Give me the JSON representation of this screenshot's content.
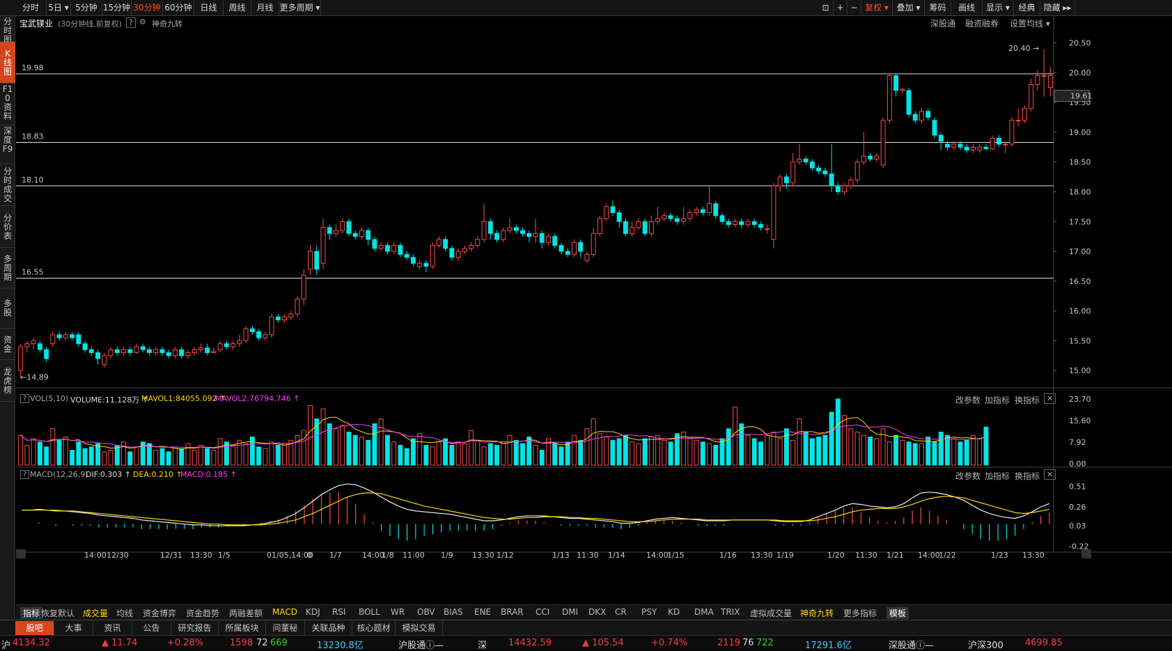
{
  "toolbar": {
    "periods": [
      "分时",
      "5日",
      "5分钟",
      "15分钟",
      "30分钟",
      "60分钟",
      "日线",
      "周线",
      "月线",
      "更多周期"
    ],
    "active_period": "30分钟",
    "right": [
      "复权",
      "叠加",
      "筹码",
      "画线",
      "显示",
      "经典",
      "隐藏"
    ],
    "active_right": "复权"
  },
  "leftnav": [
    "分时图",
    "K线图",
    "F10资料",
    "深度F9",
    "分时成交",
    "分价表",
    "多周期",
    "多股",
    "资金",
    "龙虎榜"
  ],
  "leftnav_active": "K线图",
  "title": {
    "stock": "宝武镁业",
    "desc": "(30分钟线,前复权)",
    "help": "?",
    "indicator": "神奇九转"
  },
  "title_right": [
    "深股通",
    "融资融券",
    "设置均线"
  ],
  "price_axis": [
    "20.50",
    "20.00",
    "19.50",
    "19.00",
    "18.50",
    "18.00",
    "17.50",
    "17.00",
    "16.50",
    "16.00",
    "15.50",
    "15.00"
  ],
  "current_price": "19.61",
  "hlines": [
    "19.98",
    "18.83",
    "18.10",
    "16.55"
  ],
  "high_label": "20.40",
  "low_label": "14.89",
  "vol_header": {
    "name": "VOL(5,10)",
    "volume": "VOLUME:11.128万",
    "mavol1": "MAVOL1:84055.092",
    "mavol2": "MAVOL2:76794.746"
  },
  "vol_axis": [
    "23.70",
    "15.60",
    "7.92",
    "0.00"
  ],
  "macd_header": {
    "name": "MACD(12,26,9)",
    "dif": "DIF:0.303",
    "dea": "DEA:0.210",
    "macd": "MACD:0.185"
  },
  "macd_axis": [
    "0.51",
    "0.26",
    "0.03",
    "-0.22"
  ],
  "sub_links": [
    "改参数",
    "加指标",
    "换指标"
  ],
  "time_axis": [
    "14:00",
    "12/30",
    "12/31",
    "13:30",
    "1/5",
    "01/05,14:00",
    "0",
    "1/7",
    "14:00",
    "1/8",
    "11:00",
    "1/9",
    "13:30",
    "1/12",
    "1/13",
    "11:30",
    "1/14",
    "14:00",
    "1/15",
    "1/16",
    "13:30",
    "1/19",
    "1/20",
    "11:30",
    "1/21",
    "14:00",
    "1/22",
    "1/23",
    "13:30"
  ],
  "indicators": [
    "指标",
    "恢复默认",
    "成交量",
    "均线",
    "资金博弈",
    "资金趋势",
    "两融差额",
    "MACD",
    "KDJ",
    "RSI",
    "BOLL",
    "WR",
    "OBV",
    "BIAS",
    "ENE",
    "BRAR",
    "CCI",
    "DMI",
    "DKX",
    "CR",
    "PSY",
    "KD",
    "DMA",
    "TRIX",
    "虚拟成交量",
    "神奇九转",
    "更多指标",
    "模板"
  ],
  "tabs": [
    "股吧",
    "大事",
    "资讯",
    "公告",
    "研究报告",
    "所属板块",
    "问董秘",
    "关联品种",
    "核心题材",
    "模拟交易"
  ],
  "status": {
    "sh_label": "沪",
    "sh_price": "4134.32",
    "sh_chg": "▲ 11.74",
    "sh_pct": "+0.28%",
    "sh_up": "1598",
    "sh_flat": "72",
    "sh_down": "669",
    "sh_amt": "13230.8亿",
    "hgt": "沪股通",
    "sz_label": "深",
    "sz_price": "14432.59",
    "sz_chg": "▲ 105.54",
    "sz_pct": "+0.74%",
    "sz_up": "2119",
    "sz_flat": "76",
    "sz_down": "722",
    "sz_amt": "17291.6亿",
    "sgt": "深股通",
    "hs300": "沪深300",
    "hs300_val": "4699.85"
  },
  "chart_data": {
    "type": "candlestick",
    "title": "宝武镁业 (30分钟线,前复权)",
    "ylim": [
      14.85,
      20.6
    ],
    "candles": [
      [
        15.0,
        15.4,
        14.89,
        15.45
      ],
      [
        15.4,
        15.45,
        15.3,
        15.5
      ],
      [
        15.45,
        15.5,
        15.35,
        15.55
      ],
      [
        15.45,
        15.35,
        15.3,
        15.5
      ],
      [
        15.35,
        15.2,
        15.15,
        15.4
      ],
      [
        15.45,
        15.6,
        15.4,
        15.65
      ],
      [
        15.6,
        15.55,
        15.5,
        15.65
      ],
      [
        15.55,
        15.6,
        15.5,
        15.65
      ],
      [
        15.6,
        15.55,
        15.5,
        15.65
      ],
      [
        15.6,
        15.45,
        15.4,
        15.65
      ],
      [
        15.45,
        15.35,
        15.3,
        15.5
      ],
      [
        15.35,
        15.3,
        15.25,
        15.4
      ],
      [
        15.3,
        15.2,
        15.1,
        15.35
      ],
      [
        15.1,
        15.25,
        15.05,
        15.3
      ],
      [
        15.25,
        15.35,
        15.2,
        15.4
      ],
      [
        15.35,
        15.3,
        15.25,
        15.4
      ],
      [
        15.3,
        15.35,
        15.25,
        15.4
      ],
      [
        15.35,
        15.3,
        15.25,
        15.4
      ],
      [
        15.3,
        15.4,
        15.28,
        15.45
      ],
      [
        15.4,
        15.35,
        15.3,
        15.45
      ],
      [
        15.35,
        15.3,
        15.25,
        15.4
      ],
      [
        15.3,
        15.35,
        15.25,
        15.4
      ],
      [
        15.35,
        15.3,
        15.25,
        15.4
      ],
      [
        15.3,
        15.25,
        15.2,
        15.35
      ],
      [
        15.25,
        15.35,
        15.2,
        15.4
      ],
      [
        15.35,
        15.25,
        15.2,
        15.4
      ],
      [
        15.25,
        15.3,
        15.2,
        15.35
      ],
      [
        15.3,
        15.35,
        15.25,
        15.4
      ],
      [
        15.35,
        15.38,
        15.3,
        15.45
      ],
      [
        15.38,
        15.3,
        15.25,
        15.45
      ],
      [
        15.3,
        15.32,
        15.28,
        15.38
      ],
      [
        15.35,
        15.45,
        15.3,
        15.5
      ],
      [
        15.45,
        15.4,
        15.35,
        15.5
      ],
      [
        15.4,
        15.45,
        15.35,
        15.5
      ],
      [
        15.45,
        15.5,
        15.4,
        15.6
      ],
      [
        15.5,
        15.7,
        15.45,
        15.75
      ],
      [
        15.7,
        15.65,
        15.6,
        15.75
      ],
      [
        15.65,
        15.55,
        15.5,
        15.7
      ],
      [
        15.55,
        15.6,
        15.5,
        15.65
      ],
      [
        15.6,
        15.9,
        15.55,
        15.95
      ],
      [
        15.9,
        15.85,
        15.8,
        15.95
      ],
      [
        15.85,
        15.9,
        15.8,
        15.95
      ],
      [
        15.9,
        15.95,
        15.85,
        16.0
      ],
      [
        15.95,
        16.2,
        15.9,
        16.25
      ],
      [
        16.2,
        16.6,
        16.1,
        16.7
      ],
      [
        16.7,
        17.0,
        16.6,
        17.1
      ],
      [
        17.0,
        16.7,
        16.6,
        17.1
      ],
      [
        16.8,
        17.4,
        16.7,
        17.55
      ],
      [
        17.4,
        17.3,
        17.2,
        17.45
      ],
      [
        17.3,
        17.35,
        17.25,
        17.45
      ],
      [
        17.35,
        17.5,
        17.3,
        17.55
      ],
      [
        17.5,
        17.3,
        17.25,
        17.55
      ],
      [
        17.3,
        17.25,
        17.2,
        17.35
      ],
      [
        17.25,
        17.35,
        17.2,
        17.4
      ],
      [
        17.35,
        17.2,
        17.1,
        17.4
      ],
      [
        17.2,
        17.05,
        17.0,
        17.25
      ],
      [
        17.05,
        17.1,
        17.0,
        17.15
      ],
      [
        17.1,
        17.0,
        16.95,
        17.15
      ],
      [
        17.0,
        17.1,
        16.95,
        17.15
      ],
      [
        17.1,
        16.95,
        16.9,
        17.15
      ],
      [
        16.95,
        16.9,
        16.85,
        17.0
      ],
      [
        16.9,
        16.8,
        16.75,
        16.95
      ],
      [
        16.75,
        16.8,
        16.7,
        16.85
      ],
      [
        16.8,
        16.75,
        16.65,
        16.85
      ],
      [
        16.75,
        17.1,
        16.7,
        17.15
      ],
      [
        17.1,
        17.2,
        17.05,
        17.25
      ],
      [
        17.2,
        17.05,
        17.0,
        17.25
      ],
      [
        17.05,
        16.9,
        16.85,
        17.1
      ],
      [
        16.9,
        17.0,
        16.85,
        17.05
      ],
      [
        17.0,
        17.05,
        16.95,
        17.1
      ],
      [
        17.05,
        17.1,
        17.0,
        17.15
      ],
      [
        17.1,
        17.2,
        17.05,
        17.25
      ],
      [
        17.2,
        17.5,
        17.15,
        17.8
      ],
      [
        17.5,
        17.3,
        17.2,
        17.55
      ],
      [
        17.3,
        17.2,
        17.15,
        17.35
      ],
      [
        17.2,
        17.35,
        17.15,
        17.4
      ],
      [
        17.35,
        17.4,
        17.3,
        17.55
      ],
      [
        17.4,
        17.35,
        17.3,
        17.45
      ],
      [
        17.35,
        17.3,
        17.25,
        17.4
      ],
      [
        17.3,
        17.25,
        17.15,
        17.35
      ],
      [
        17.25,
        17.3,
        17.15,
        17.55
      ],
      [
        17.3,
        17.15,
        17.05,
        17.35
      ],
      [
        17.15,
        17.25,
        17.1,
        17.3
      ],
      [
        17.25,
        17.1,
        17.05,
        17.3
      ],
      [
        17.1,
        17.0,
        16.95,
        17.15
      ],
      [
        17.0,
        16.95,
        16.9,
        17.05
      ],
      [
        16.95,
        17.15,
        16.9,
        17.2
      ],
      [
        17.15,
        17.0,
        16.9,
        17.2
      ],
      [
        16.85,
        16.95,
        16.8,
        17.0
      ],
      [
        16.95,
        17.3,
        16.9,
        17.4
      ],
      [
        17.3,
        17.55,
        17.25,
        17.6
      ],
      [
        17.55,
        17.75,
        17.5,
        17.8
      ],
      [
        17.75,
        17.65,
        17.6,
        17.85
      ],
      [
        17.65,
        17.5,
        17.4,
        17.7
      ],
      [
        17.5,
        17.3,
        17.25,
        17.55
      ],
      [
        17.3,
        17.4,
        17.25,
        17.5
      ],
      [
        17.4,
        17.5,
        17.35,
        17.55
      ],
      [
        17.5,
        17.3,
        17.25,
        17.55
      ],
      [
        17.3,
        17.5,
        17.25,
        17.6
      ],
      [
        17.5,
        17.55,
        17.45,
        17.75
      ],
      [
        17.55,
        17.6,
        17.5,
        17.65
      ],
      [
        17.6,
        17.55,
        17.5,
        17.65
      ],
      [
        17.55,
        17.5,
        17.45,
        17.6
      ],
      [
        17.5,
        17.55,
        17.45,
        17.75
      ],
      [
        17.55,
        17.65,
        17.5,
        17.7
      ],
      [
        17.65,
        17.7,
        17.6,
        17.75
      ],
      [
        17.7,
        17.65,
        17.6,
        17.75
      ],
      [
        17.65,
        17.8,
        17.6,
        18.1
      ],
      [
        17.8,
        17.6,
        17.55,
        17.85
      ],
      [
        17.6,
        17.5,
        17.45,
        17.65
      ],
      [
        17.5,
        17.45,
        17.4,
        17.55
      ],
      [
        17.45,
        17.5,
        17.4,
        17.55
      ],
      [
        17.5,
        17.45,
        17.4,
        17.55
      ],
      [
        17.45,
        17.5,
        17.4,
        17.55
      ],
      [
        17.5,
        17.45,
        17.4,
        17.55
      ],
      [
        17.45,
        17.4,
        17.35,
        17.5
      ],
      [
        17.38,
        17.38,
        17.3,
        17.45
      ],
      [
        17.2,
        18.1,
        17.05,
        18.15
      ],
      [
        18.1,
        18.25,
        18.0,
        18.3
      ],
      [
        18.25,
        18.15,
        18.05,
        18.3
      ],
      [
        18.15,
        18.5,
        18.1,
        18.65
      ],
      [
        18.5,
        18.55,
        18.45,
        18.8
      ],
      [
        18.55,
        18.5,
        18.45,
        18.6
      ],
      [
        18.5,
        18.4,
        18.35,
        18.55
      ],
      [
        18.4,
        18.35,
        18.3,
        18.45
      ],
      [
        18.35,
        18.3,
        18.25,
        18.4
      ],
      [
        18.3,
        18.1,
        18.0,
        18.8
      ],
      [
        18.1,
        18.0,
        17.95,
        18.15
      ],
      [
        18.0,
        18.1,
        17.95,
        18.15
      ],
      [
        18.1,
        18.2,
        18.05,
        18.25
      ],
      [
        18.2,
        18.5,
        18.15,
        18.55
      ],
      [
        18.5,
        18.6,
        18.45,
        19.0
      ],
      [
        18.6,
        18.55,
        18.5,
        18.65
      ],
      [
        18.55,
        18.6,
        18.5,
        18.65
      ],
      [
        18.45,
        19.2,
        18.4,
        19.25
      ],
      [
        19.2,
        19.95,
        19.15,
        19.98
      ],
      [
        19.95,
        19.7,
        19.6,
        19.98
      ],
      [
        19.7,
        19.72,
        19.65,
        19.75
      ],
      [
        19.7,
        19.3,
        19.25,
        19.75
      ],
      [
        19.3,
        19.2,
        19.15,
        19.35
      ],
      [
        19.2,
        19.35,
        19.15,
        19.4
      ],
      [
        19.35,
        19.25,
        19.2,
        19.4
      ],
      [
        19.2,
        18.95,
        18.9,
        19.25
      ],
      [
        18.95,
        18.85,
        18.7,
        19.0
      ],
      [
        18.8,
        18.75,
        18.7,
        18.85
      ],
      [
        18.75,
        18.8,
        18.7,
        18.85
      ],
      [
        18.8,
        18.75,
        18.7,
        18.85
      ],
      [
        18.75,
        18.7,
        18.65,
        18.8
      ],
      [
        18.7,
        18.75,
        18.65,
        18.8
      ],
      [
        18.7,
        18.75,
        18.65,
        18.8
      ],
      [
        18.75,
        18.72,
        18.7,
        18.8
      ],
      [
        18.72,
        18.9,
        18.7,
        18.95
      ],
      [
        18.9,
        18.8,
        18.75,
        18.95
      ],
      [
        18.8,
        18.8,
        18.65,
        18.85
      ],
      [
        18.8,
        19.2,
        18.75,
        19.25
      ],
      [
        19.2,
        19.2,
        19.1,
        19.4
      ],
      [
        19.2,
        19.4,
        19.15,
        19.45
      ],
      [
        19.4,
        19.8,
        19.35,
        19.9
      ],
      [
        19.8,
        19.95,
        19.7,
        20.05
      ],
      [
        19.95,
        19.95,
        19.6,
        20.4
      ],
      [
        19.75,
        19.95,
        19.6,
        20.1
      ]
    ],
    "volume": [
      18,
      12,
      16,
      14,
      11,
      22,
      15,
      17,
      9,
      14,
      10,
      11,
      13,
      8,
      9,
      12,
      14,
      8,
      11,
      14,
      13,
      9,
      10,
      8,
      11,
      10,
      13,
      9,
      12,
      10,
      9,
      16,
      14,
      12,
      15,
      13,
      17,
      11,
      10,
      14,
      12,
      13,
      15,
      18,
      21,
      36,
      28,
      34,
      25,
      22,
      24,
      20,
      18,
      17,
      15,
      25,
      28,
      18,
      14,
      12,
      10,
      16,
      19,
      12,
      11,
      14,
      16,
      12,
      14,
      13,
      21,
      15,
      11,
      13,
      12,
      14,
      18,
      15,
      13,
      17,
      12,
      9,
      16,
      13,
      11,
      14,
      18,
      15,
      22,
      28,
      19,
      17,
      15,
      16,
      18,
      14,
      13,
      16,
      17,
      18,
      15,
      14,
      19,
      20,
      16,
      15,
      14,
      13,
      12,
      16,
      22,
      35,
      25,
      18,
      16,
      14,
      18,
      20,
      16,
      22,
      15,
      28,
      20,
      16,
      17,
      18,
      32,
      40,
      30,
      22,
      20,
      18,
      17,
      16,
      22,
      14,
      18,
      15,
      14,
      13,
      13,
      17,
      14,
      20,
      18,
      16,
      14,
      15,
      18,
      16,
      23
    ],
    "macd": {
      "dif": [
        0.22,
        0.22,
        0.23,
        0.22,
        0.21,
        0.21,
        0.2,
        0.19,
        0.18,
        0.16,
        0.15,
        0.14,
        0.13,
        0.12,
        0.1,
        0.09,
        0.08,
        0.07,
        0.06,
        0.05,
        0.04,
        0.04,
        0.03,
        0.03,
        0.03,
        0.03,
        0.03,
        0.04,
        0.05,
        0.07,
        0.09,
        0.13,
        0.18,
        0.25,
        0.33,
        0.41,
        0.47,
        0.52,
        0.54,
        0.53,
        0.49,
        0.44,
        0.38,
        0.32,
        0.27,
        0.23,
        0.21,
        0.2,
        0.19,
        0.18,
        0.17,
        0.15,
        0.13,
        0.11,
        0.09,
        0.09,
        0.1,
        0.12,
        0.14,
        0.15,
        0.15,
        0.15,
        0.14,
        0.13,
        0.12,
        0.12,
        0.11,
        0.1,
        0.09,
        0.08,
        0.06,
        0.06,
        0.07,
        0.09,
        0.11,
        0.12,
        0.13,
        0.12,
        0.11,
        0.1,
        0.09,
        0.09,
        0.09,
        0.1,
        0.1,
        0.1,
        0.1,
        0.1,
        0.09,
        0.08,
        0.08,
        0.08,
        0.1,
        0.14,
        0.18,
        0.22,
        0.27,
        0.3,
        0.29,
        0.27,
        0.26,
        0.25,
        0.26,
        0.3,
        0.37,
        0.43,
        0.44,
        0.43,
        0.41,
        0.38,
        0.34,
        0.28,
        0.22,
        0.18,
        0.15,
        0.13,
        0.12,
        0.15,
        0.2,
        0.26,
        0.3
      ],
      "dea": [
        0.22,
        0.22,
        0.22,
        0.22,
        0.22,
        0.21,
        0.21,
        0.2,
        0.19,
        0.18,
        0.17,
        0.16,
        0.15,
        0.14,
        0.13,
        0.12,
        0.11,
        0.1,
        0.09,
        0.08,
        0.07,
        0.06,
        0.05,
        0.05,
        0.04,
        0.04,
        0.04,
        0.04,
        0.04,
        0.05,
        0.06,
        0.08,
        0.1,
        0.14,
        0.18,
        0.23,
        0.28,
        0.33,
        0.38,
        0.41,
        0.43,
        0.43,
        0.42,
        0.39,
        0.36,
        0.33,
        0.3,
        0.27,
        0.25,
        0.23,
        0.21,
        0.19,
        0.17,
        0.15,
        0.13,
        0.12,
        0.11,
        0.11,
        0.12,
        0.13,
        0.13,
        0.14,
        0.14,
        0.14,
        0.13,
        0.13,
        0.12,
        0.12,
        0.11,
        0.1,
        0.09,
        0.08,
        0.08,
        0.08,
        0.09,
        0.1,
        0.11,
        0.11,
        0.11,
        0.11,
        0.1,
        0.1,
        0.1,
        0.1,
        0.1,
        0.1,
        0.1,
        0.1,
        0.1,
        0.09,
        0.09,
        0.09,
        0.09,
        0.1,
        0.12,
        0.14,
        0.17,
        0.2,
        0.22,
        0.23,
        0.24,
        0.24,
        0.24,
        0.26,
        0.29,
        0.33,
        0.36,
        0.38,
        0.39,
        0.38,
        0.37,
        0.34,
        0.31,
        0.28,
        0.25,
        0.22,
        0.19,
        0.18,
        0.19,
        0.21,
        0.23
      ]
    }
  }
}
